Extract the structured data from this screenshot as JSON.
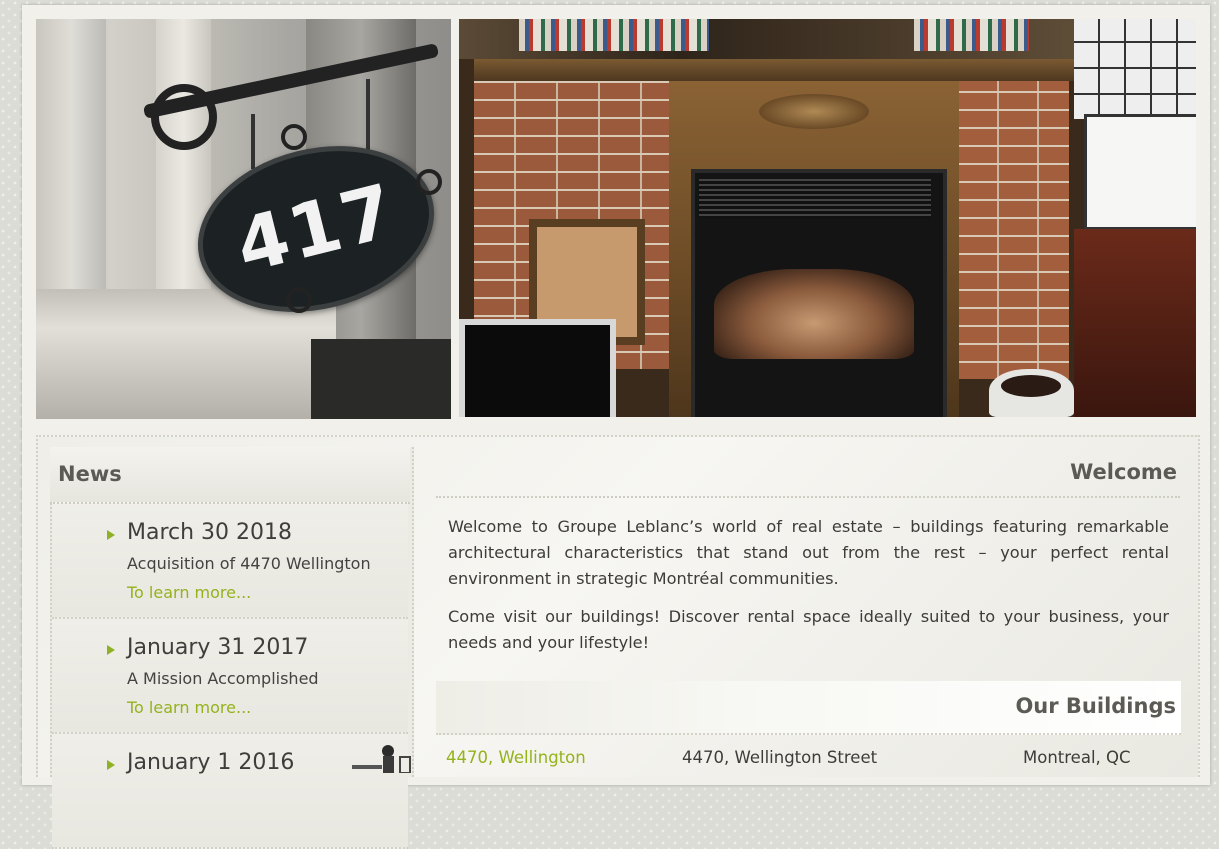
{
  "hero": {
    "sign_number": "417",
    "left_photo": "building-sign-photo",
    "right_photo": "fireplace-photo"
  },
  "news": {
    "title": "News",
    "items": [
      {
        "date": "March 30 2018",
        "description": "Acquisition of 4470 Wellington",
        "link": "To learn more..."
      },
      {
        "date": "January 31 2017",
        "description": "A Mission Accomplished",
        "link": "To learn more..."
      },
      {
        "date": "January 1 2016"
      }
    ]
  },
  "welcome": {
    "title": "Welcome",
    "paragraph1": "Welcome to Groupe Leblanc’s world of real estate – buildings featuring remarkable architectural characteristics that stand out from the rest – your perfect rental environment in strategic Montréal communities.",
    "paragraph2": "Come visit our buildings! Discover rental space ideally suited to your business, your needs and your lifestyle!"
  },
  "buildings": {
    "title": "Our Buildings",
    "rows": [
      {
        "name": "4470, Wellington",
        "address": "4470, Wellington Street",
        "city": "Montreal, QC"
      }
    ]
  },
  "colors": {
    "accent_green": "#94b21c",
    "heading_gray": "#5b5a54",
    "text": "#3d3c38"
  }
}
